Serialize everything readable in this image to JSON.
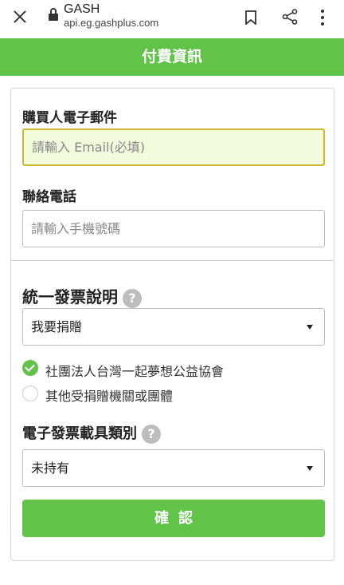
{
  "browser": {
    "site_title": "GASH",
    "url": "api.eg.gashplus.com"
  },
  "header": {
    "title": "付費資訊"
  },
  "form": {
    "email_label": "購買人電子郵件",
    "email_placeholder": "請輸入 Email(必填)",
    "phone_label": "聯絡電話",
    "phone_placeholder": "請輸入手機號碼",
    "invoice_label": "統一發票說明",
    "help_icon": "?",
    "invoice_selected": "我要捐贈",
    "donation_options": [
      {
        "label": "社團法人台灣一起夢想公益協會",
        "checked": true
      },
      {
        "label": "其他受捐贈機關或團體",
        "checked": false
      }
    ],
    "carrier_label": "電子發票載具類別",
    "carrier_selected": "未持有",
    "confirm_label": "確認"
  },
  "colors": {
    "brand_green": "#62c349",
    "email_focus_bg": "#f2fbdc",
    "email_focus_border": "#c9ba2f"
  }
}
